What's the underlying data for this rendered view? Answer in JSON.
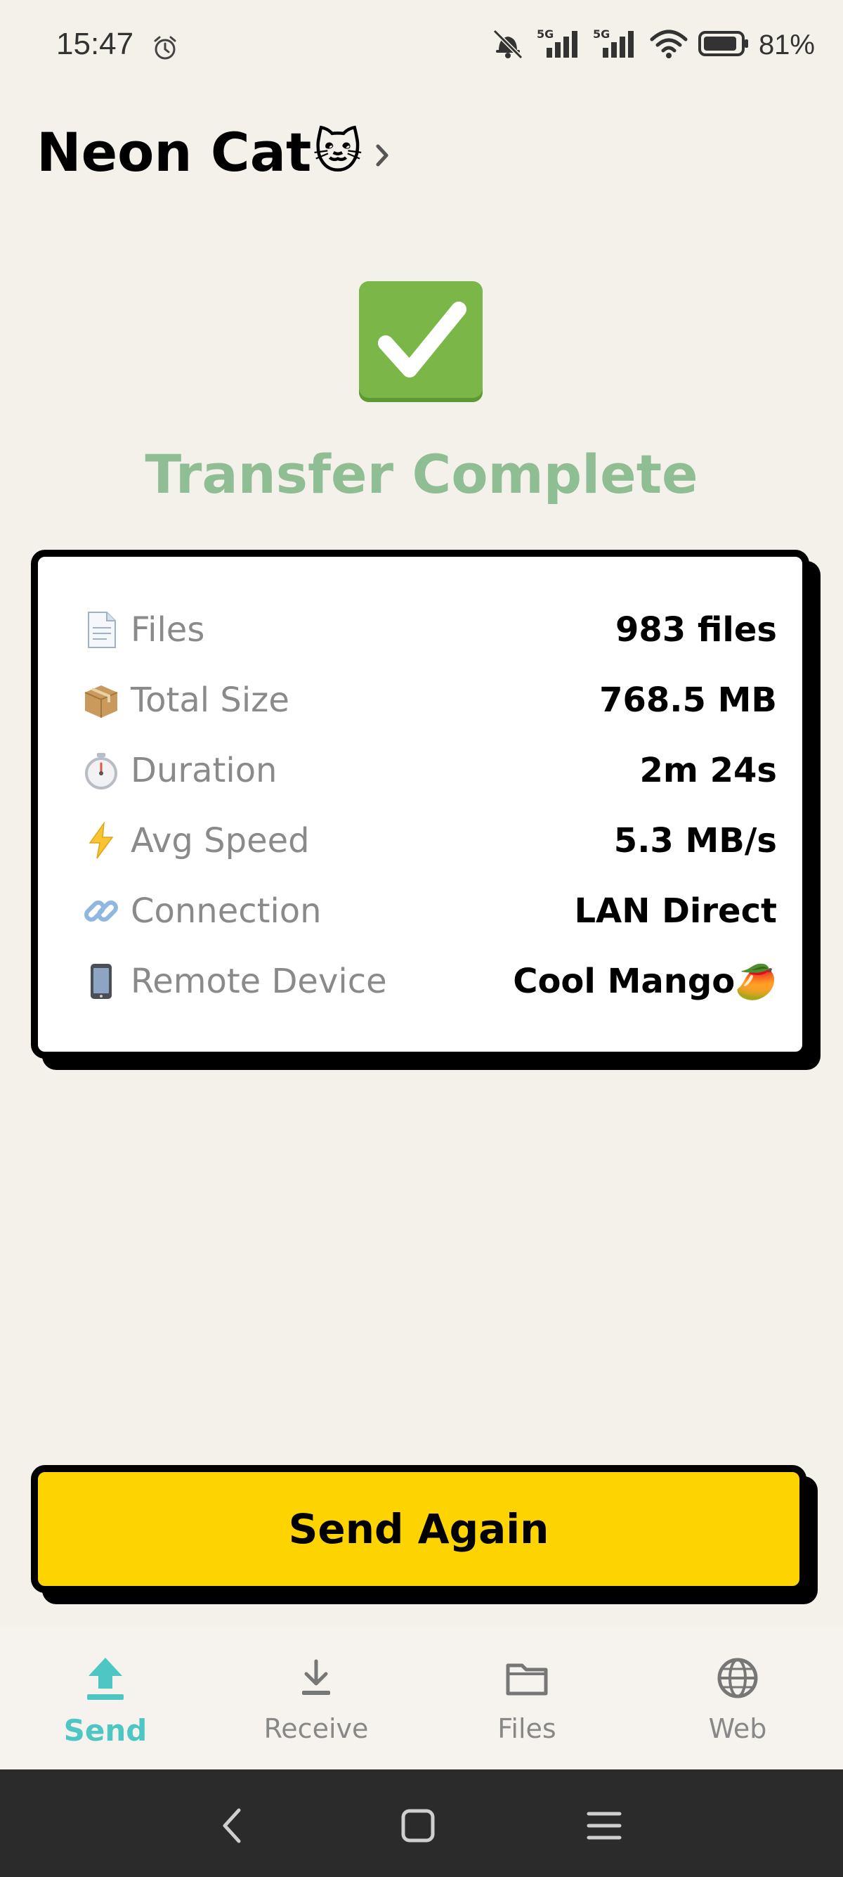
{
  "status_bar": {
    "time": "15:47",
    "battery": "81%",
    "icons": [
      "alarm-icon",
      "bell-muted-icon",
      "signal-5g-icon",
      "signal-5g-icon",
      "wifi-icon",
      "battery-icon"
    ]
  },
  "header": {
    "device_name": "Neon Cat",
    "device_emoji": "🐱"
  },
  "result": {
    "icon": "check-mark-icon",
    "title": "Transfer Complete"
  },
  "summary": {
    "rows": [
      {
        "icon": "document-icon",
        "label": "Files",
        "value": "983 files"
      },
      {
        "icon": "package-icon",
        "label": "Total Size",
        "value": "768.5 MB"
      },
      {
        "icon": "stopwatch-icon",
        "label": "Duration",
        "value": "2m 24s"
      },
      {
        "icon": "lightning-icon",
        "label": "Avg Speed",
        "value": "5.3 MB/s"
      },
      {
        "icon": "link-icon",
        "label": "Connection",
        "value": "LAN Direct"
      },
      {
        "icon": "phone-icon",
        "label": "Remote Device",
        "value": "Cool Mango",
        "value_emoji": "🥭"
      }
    ]
  },
  "actions": {
    "send_again": "Send Again"
  },
  "bottom_nav": {
    "items": [
      {
        "label": "Send",
        "icon": "upload-icon",
        "active": true
      },
      {
        "label": "Receive",
        "icon": "download-icon",
        "active": false
      },
      {
        "label": "Files",
        "icon": "folder-icon",
        "active": false
      },
      {
        "label": "Web",
        "icon": "globe-icon",
        "active": false
      }
    ]
  },
  "colors": {
    "background": "#f4f1ea",
    "accent_teal": "#4ec7c4",
    "button_yellow": "#fdd400",
    "success_green": "#8fbe94",
    "check_green": "#7ab648"
  }
}
